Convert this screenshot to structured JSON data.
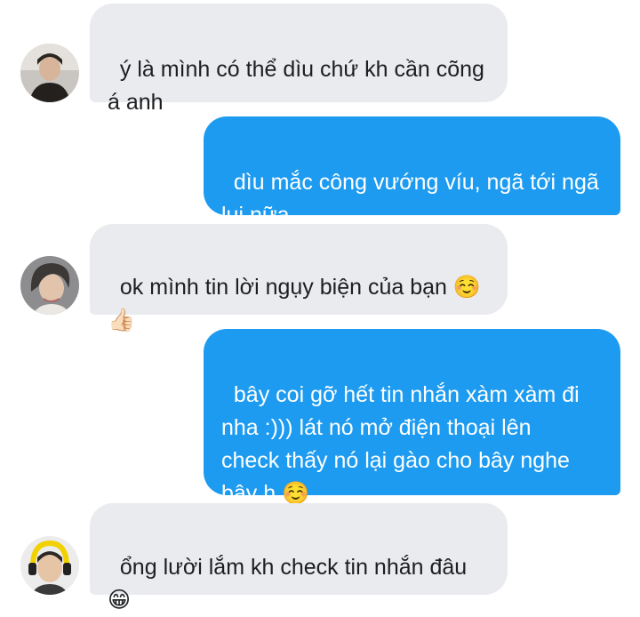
{
  "messages": [
    {
      "side": "in",
      "text": "ý là mình có thể dìu chứ kh cần cõng\ná anh"
    },
    {
      "side": "out",
      "text": "dìu mắc công vướng víu, ngã tới ngã\nlui nữa"
    },
    {
      "side": "in",
      "text": "ok mình tin lời ngụy biện của bạn ☺️\n👍🏻"
    },
    {
      "side": "out",
      "text": "bây coi gỡ hết tin nhắn xàm xàm đi\nnha :))) lát nó mở điện thoại lên\ncheck thấy nó lại gào cho bây nghe\nbây h ☺️"
    },
    {
      "side": "in",
      "text": "ổng lười lắm kh check tin nhắn đâu\n😁"
    }
  ],
  "avatars": [
    "person-photo-avatar",
    "person-photo-avatar",
    "person-with-headphones-avatar"
  ],
  "colors": {
    "incoming_bg": "#e9ebee",
    "outgoing_bg": "#1d9bf0",
    "incoming_text": "#1c1e21",
    "outgoing_text": "#ffffff"
  }
}
